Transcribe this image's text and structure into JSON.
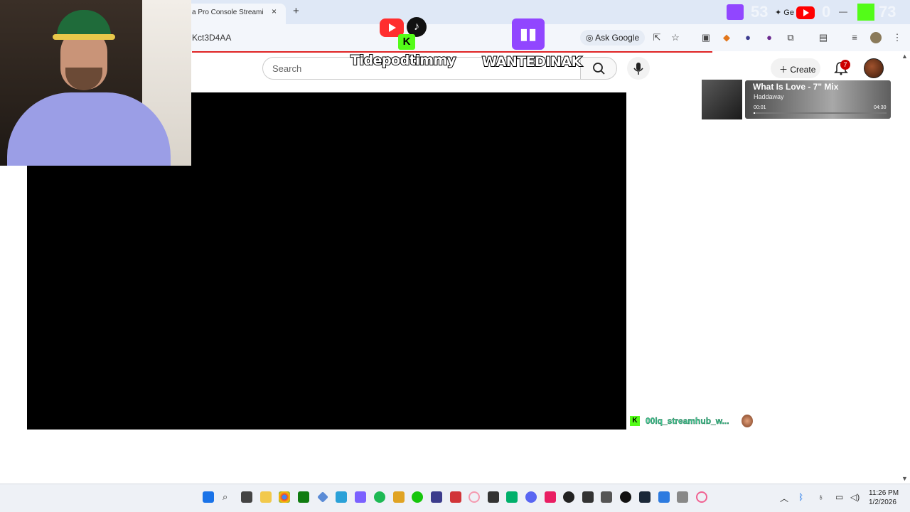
{
  "browser": {
    "tab_title": "a Pro Console Streami",
    "tab_close": "×",
    "new_tab": "+",
    "url_fragment": "Kct3D4AA",
    "ask_google": "Ask Google",
    "window_minimize": "—",
    "gem_text": "✦ Ge"
  },
  "youtube": {
    "search_placeholder": "Search",
    "create_label": "Create",
    "notification_count": "7"
  },
  "overlay": {
    "streamer_left": "Tidepodtimmy",
    "streamer_right": "WANTEDINAK",
    "viewer_counts": {
      "twitch": "53",
      "youtube": "0",
      "kick": "73"
    }
  },
  "now_playing": {
    "title": "What Is Love - 7\" Mix",
    "artist": "Haddaway",
    "elapsed": "00:01",
    "total": "04:30",
    "progress": 0.01
  },
  "chat": {
    "username": "00lq_streamhub_w..."
  },
  "taskbar": {
    "time": "11:26 PM",
    "date": "1/2/2026"
  },
  "colors": {
    "twitch": "#9146ff",
    "kick": "#53fc18",
    "youtube": "#ff0000",
    "progress_red": "#e02424"
  }
}
